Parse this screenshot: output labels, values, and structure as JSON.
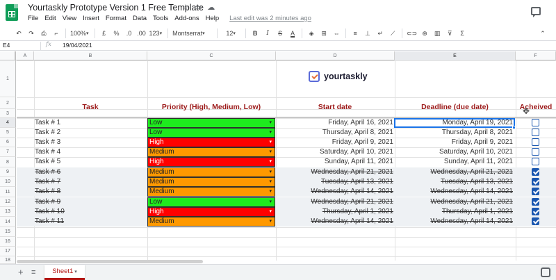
{
  "window": {
    "doc_title": "Yourtaskly Prototype Version 1 Free Template",
    "last_edit": "Last edit was 2 minutes ago"
  },
  "menu": [
    "File",
    "Edit",
    "View",
    "Insert",
    "Format",
    "Data",
    "Tools",
    "Add-ons",
    "Help"
  ],
  "toolbar": {
    "zoom": "100%",
    "currency": "£",
    "percent": "%",
    "dec_decrease": ".0",
    "dec_increase": ".00",
    "more_formats": "123",
    "font": "Montserrat",
    "font_size": "12",
    "bold": "B",
    "italic": "I",
    "strike": "S",
    "text_color": "A"
  },
  "formula_bar": {
    "cell_ref": "E4",
    "fx": "fx",
    "value": "19/04/2021"
  },
  "columns": [
    "A",
    "B",
    "C",
    "D",
    "E",
    "F"
  ],
  "rows": [
    "1",
    "2",
    "3",
    "4",
    "5",
    "6",
    "7",
    "8",
    "9",
    "10",
    "11",
    "12",
    "13",
    "14",
    "15",
    "16",
    "17",
    "18"
  ],
  "brand": "yourtaskly",
  "headers": {
    "task": "Task",
    "priority": "Priority (High, Medium, Low)",
    "start": "Start date",
    "deadline": "Deadline (due date)",
    "achieved": "Acheived"
  },
  "tasks": [
    {
      "task": "Task # 1",
      "priority": "Low",
      "start": "Friday, April 16, 2021",
      "deadline": "Monday, April 19, 2021",
      "done": false
    },
    {
      "task": "Task # 2",
      "priority": "Low",
      "start": "Thursday, April 8, 2021",
      "deadline": "Thursday, April 8, 2021",
      "done": false
    },
    {
      "task": "Task # 3",
      "priority": "High",
      "start": "Friday, April 9, 2021",
      "deadline": "Friday, April 9, 2021",
      "done": false
    },
    {
      "task": "Task # 4",
      "priority": "Medium",
      "start": "Saturday, April 10, 2021",
      "deadline": "Saturday, April 10, 2021",
      "done": false
    },
    {
      "task": "Task # 5",
      "priority": "High",
      "start": "Sunday, April 11, 2021",
      "deadline": "Sunday, April 11, 2021",
      "done": false
    },
    {
      "task": "Task # 6",
      "priority": "Medium",
      "start": "Wednesday, April 21, 2021",
      "deadline": "Wednesday, April 21, 2021",
      "done": true
    },
    {
      "task": "Task # 7",
      "priority": "Medium",
      "start": "Tuesday, April 13, 2021",
      "deadline": "Tuesday, April 13, 2021",
      "done": true
    },
    {
      "task": "Task # 8",
      "priority": "Medium",
      "start": "Wednesday, April 14, 2021",
      "deadline": "Wednesday, April 14, 2021",
      "done": true
    },
    {
      "task": "Task # 9",
      "priority": "Low",
      "start": "Wednesday, April 21, 2021",
      "deadline": "Wednesday, April 21, 2021",
      "done": true
    },
    {
      "task": "Task # 10",
      "priority": "High",
      "start": "Thursday, April 1, 2021",
      "deadline": "Thursday, April 1, 2021",
      "done": true
    },
    {
      "task": "Task # 11",
      "priority": "Medium",
      "start": "Wednesday, April 14, 2021",
      "deadline": "Wednesday, April 14, 2021",
      "done": true
    }
  ],
  "sheet_tab": "Sheet1",
  "icons": {
    "app": "google-sheets-icon",
    "star": "star-icon",
    "move": "move-to-folder-icon",
    "cloud": "cloud-saved-icon",
    "comments": "comment-history-icon",
    "add_sheet": "plus-icon",
    "all_sheets": "list-icon",
    "explore": "explore-icon"
  },
  "colors": {
    "header_text": "#9c1a1a",
    "low": "#1eeb1e",
    "medium": "#ff9900",
    "high": "#ff0000",
    "checkbox": "#1a57b0",
    "selection": "#1a73e8"
  }
}
